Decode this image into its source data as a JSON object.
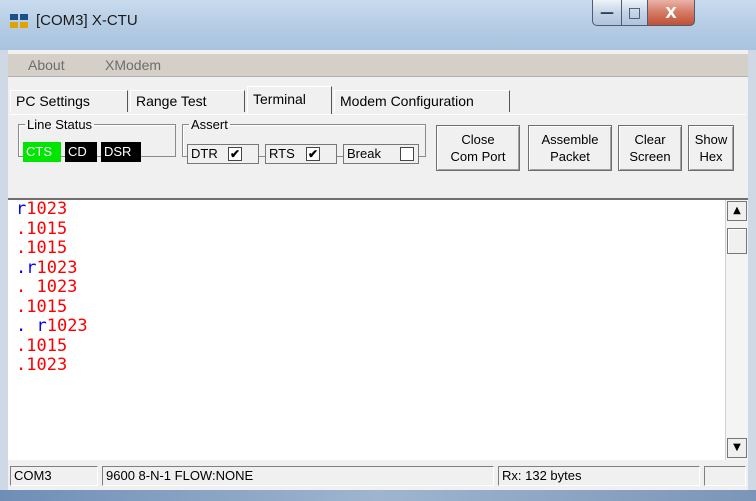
{
  "window": {
    "title": "[COM3] X-CTU",
    "minimize_glyph": "—",
    "maximize_glyph": "□",
    "close_glyph": "X"
  },
  "menu": [
    "About",
    "XModem"
  ],
  "tabs": [
    {
      "label": "PC Settings",
      "active": false
    },
    {
      "label": "Range Test",
      "active": false
    },
    {
      "label": "Terminal",
      "active": true
    },
    {
      "label": "Modem Configuration",
      "active": false
    }
  ],
  "line_status": {
    "legend": "Line Status",
    "indicators": [
      {
        "label": "CTS",
        "state": "on"
      },
      {
        "label": "CD",
        "state": "off"
      },
      {
        "label": "DSR",
        "state": "off"
      }
    ]
  },
  "assert": {
    "legend": "Assert",
    "items": [
      {
        "label": "DTR",
        "checked": true
      },
      {
        "label": "RTS",
        "checked": true
      },
      {
        "label": "Break",
        "checked": false
      }
    ],
    "check_glyph": "✔"
  },
  "buttons": {
    "close_port": [
      "Close",
      "Com Port"
    ],
    "assemble_packet": [
      "Assemble",
      "Packet"
    ],
    "clear_screen": [
      "Clear",
      "Screen"
    ],
    "show_hex": [
      "Show",
      "Hex"
    ]
  },
  "terminal": {
    "lines": [
      [
        {
          "text": "r",
          "color": "blue"
        },
        {
          "text": "1023",
          "color": "red"
        }
      ],
      [
        {
          "text": ".1015",
          "color": "red"
        }
      ],
      [
        {
          "text": ".1015",
          "color": "red"
        }
      ],
      [
        {
          "text": ".r",
          "color": "blue"
        },
        {
          "text": "1023",
          "color": "red"
        }
      ],
      [
        {
          "text": ". 1023",
          "color": "red"
        }
      ],
      [
        {
          "text": ".1015",
          "color": "red"
        }
      ],
      [
        {
          "text": ". r",
          "color": "blue"
        },
        {
          "text": "1023",
          "color": "red"
        }
      ],
      [
        {
          "text": ".1015",
          "color": "red"
        }
      ],
      [
        {
          "text": ".1023",
          "color": "red"
        }
      ]
    ],
    "scroll_up_glyph": "▲",
    "scroll_down_glyph": "▼"
  },
  "statusbar": {
    "port": "COM3",
    "settings": "9600 8-N-1  FLOW:NONE",
    "rx": "Rx: 132 bytes",
    "extra": ""
  }
}
